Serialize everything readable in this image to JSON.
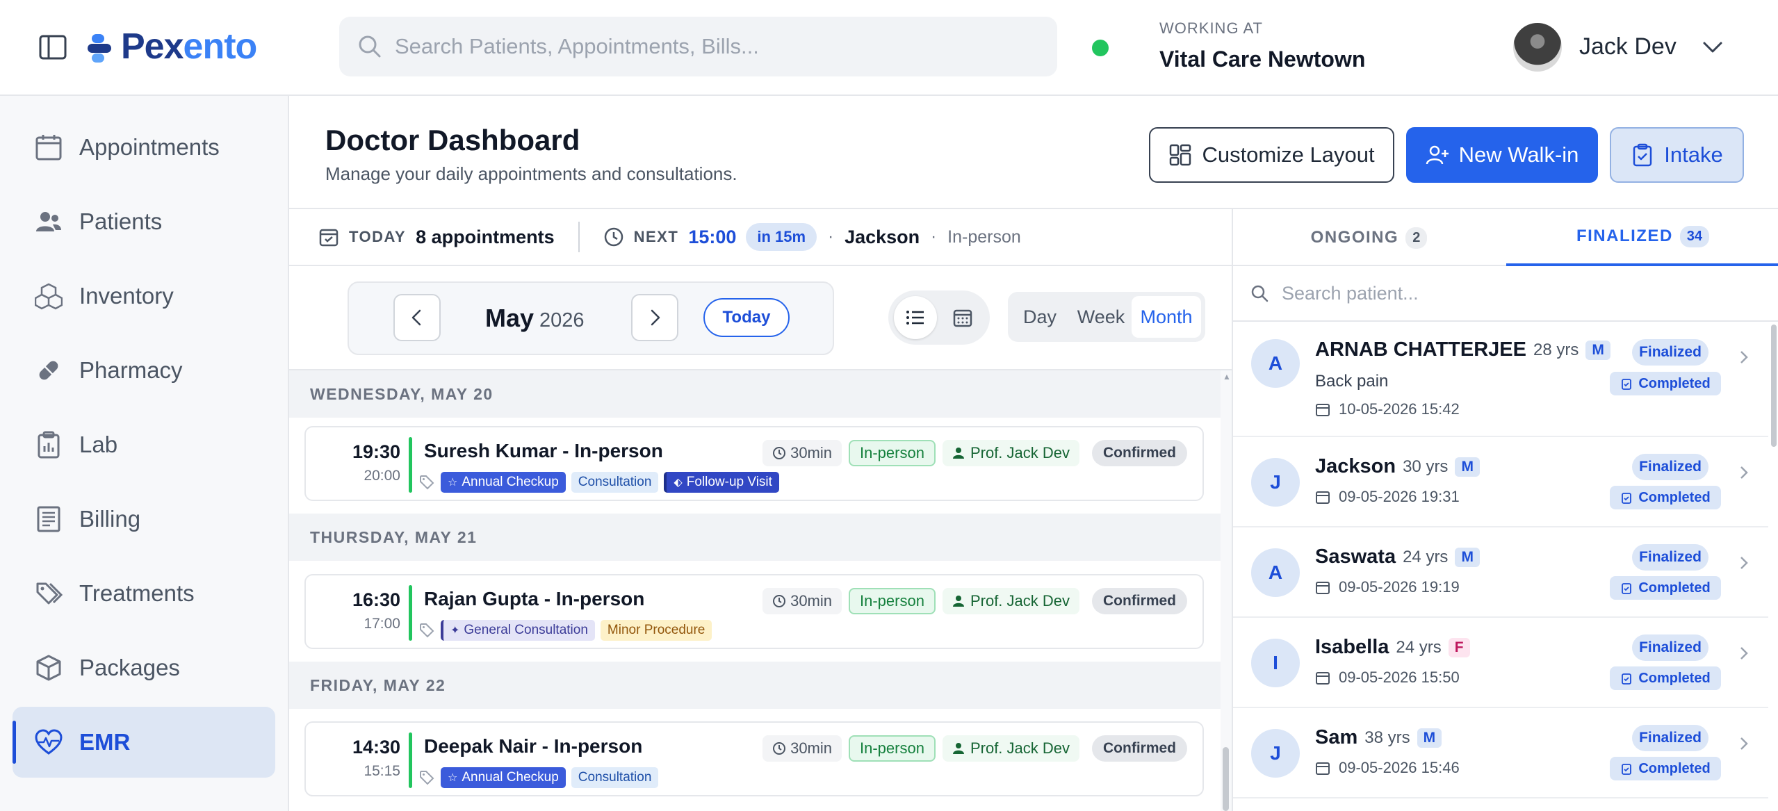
{
  "app": {
    "logo_prefix": "Pex",
    "logo_suffix": "ento",
    "search_placeholder": "Search Patients, Appointments, Bills...",
    "working_label": "WORKING AT",
    "working_value": "Vital Care Newtown",
    "user_name": "Jack Dev"
  },
  "sidebar": {
    "items": [
      {
        "label": "Appointments",
        "icon": "calendar-icon"
      },
      {
        "label": "Patients",
        "icon": "users-icon"
      },
      {
        "label": "Inventory",
        "icon": "boxes-icon"
      },
      {
        "label": "Pharmacy",
        "icon": "pill-icon"
      },
      {
        "label": "Lab",
        "icon": "clipboard-chart-icon"
      },
      {
        "label": "Billing",
        "icon": "receipt-icon"
      },
      {
        "label": "Treatments",
        "icon": "tags-icon"
      },
      {
        "label": "Packages",
        "icon": "package-icon"
      },
      {
        "label": "EMR",
        "icon": "heart-pulse-icon",
        "active": true
      }
    ]
  },
  "header": {
    "title": "Doctor Dashboard",
    "subtitle": "Manage your daily appointments and consultations.",
    "customize_label": "Customize Layout",
    "walkin_label": "New Walk-in",
    "intake_label": "Intake"
  },
  "summary": {
    "today_key": "TODAY",
    "today_value": "8 appointments",
    "next_key": "NEXT",
    "next_time": "15:00",
    "next_in": "in 15m",
    "next_name": "Jackson",
    "next_mode": "In-person"
  },
  "calendar": {
    "month": "May",
    "year": "2026",
    "today_label": "Today",
    "ranges": [
      "Day",
      "Week",
      "Month"
    ],
    "active_range": "Month"
  },
  "days": [
    {
      "label": "WEDNESDAY, MAY 20",
      "appointment": {
        "start": "19:30",
        "end": "20:00",
        "title": "Suresh Kumar - In-person",
        "duration": "30min",
        "mode": "In-person",
        "doctor": "Prof. Jack Dev",
        "status": "Confirmed",
        "tags": [
          {
            "label": "Annual Checkup",
            "style": "blue",
            "icon": "star-icon"
          },
          {
            "label": "Consultation",
            "style": "light",
            "icon": ""
          },
          {
            "label": "Follow-up Visit",
            "style": "blue2",
            "icon": "tag-icon"
          }
        ]
      }
    },
    {
      "label": "THURSDAY, MAY 21",
      "appointment": {
        "start": "16:30",
        "end": "17:00",
        "title": "Rajan Gupta - In-person",
        "duration": "30min",
        "mode": "In-person",
        "doctor": "Prof. Jack Dev",
        "status": "Confirmed",
        "tags": [
          {
            "label": "General Consultation",
            "style": "indigo",
            "icon": "sparkle-icon"
          },
          {
            "label": "Minor Procedure",
            "style": "yellow",
            "icon": ""
          }
        ]
      }
    },
    {
      "label": "FRIDAY, MAY 22",
      "appointment": {
        "start": "14:30",
        "end": "15:15",
        "title": "Deepak Nair - In-person",
        "duration": "30min",
        "mode": "In-person",
        "doctor": "Prof. Jack Dev",
        "status": "Confirmed",
        "tags": [
          {
            "label": "Annual Checkup",
            "style": "blue",
            "icon": "star-icon"
          },
          {
            "label": "Consultation",
            "style": "light",
            "icon": ""
          }
        ]
      }
    }
  ],
  "panel": {
    "tab_ongoing": "ONGOING",
    "tab_ongoing_count": "2",
    "tab_finalized": "FINALIZED",
    "tab_finalized_count": "34",
    "search_placeholder": "Search patient...",
    "patients": [
      {
        "initial": "A",
        "name": "ARNAB CHATTERJEE",
        "age": "28 yrs",
        "sex": "M",
        "note": "Back pain",
        "date": "10-05-2026 15:42",
        "status": "Finalized",
        "sub_status": "Completed"
      },
      {
        "initial": "J",
        "name": "Jackson",
        "age": "30 yrs",
        "sex": "M",
        "note": "",
        "date": "09-05-2026 19:31",
        "status": "Finalized",
        "sub_status": "Completed"
      },
      {
        "initial": "A",
        "name": "Saswata",
        "age": "24 yrs",
        "sex": "M",
        "note": "",
        "date": "09-05-2026 19:19",
        "status": "Finalized",
        "sub_status": "Completed"
      },
      {
        "initial": "I",
        "name": "Isabella",
        "age": "24 yrs",
        "sex": "F",
        "note": "",
        "date": "09-05-2026 15:50",
        "status": "Finalized",
        "sub_status": "Completed"
      },
      {
        "initial": "J",
        "name": "Sam",
        "age": "38 yrs",
        "sex": "M",
        "note": "",
        "date": "09-05-2026 15:46",
        "status": "Finalized",
        "sub_status": "Completed"
      }
    ]
  },
  "colors": {
    "brand": "#2563eb",
    "brand_dark": "#1e3a8a",
    "success": "#22c55e"
  }
}
